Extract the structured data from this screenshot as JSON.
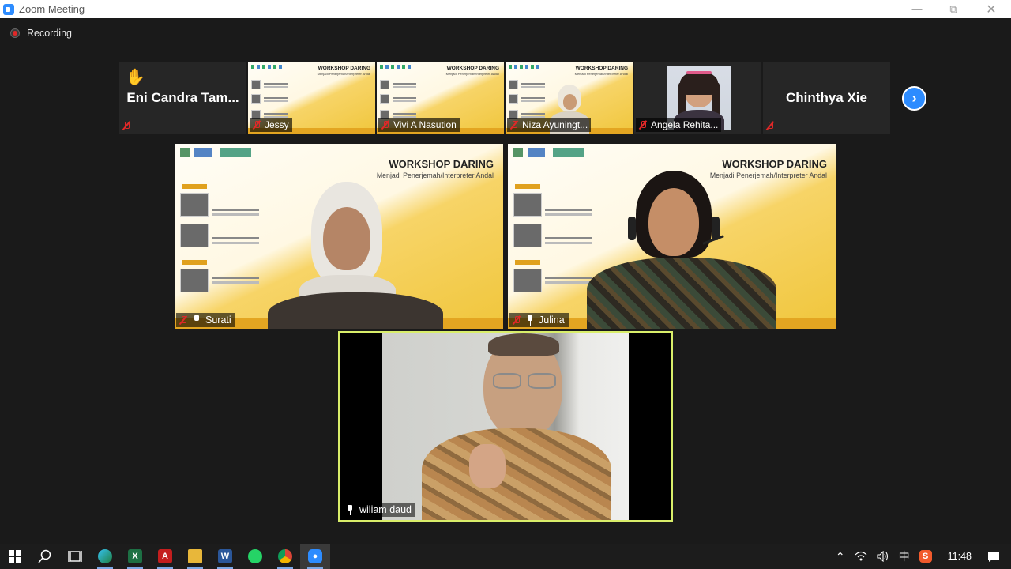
{
  "window": {
    "title": "Zoom Meeting"
  },
  "recording": {
    "label": "Recording"
  },
  "gallery_strip": [
    {
      "name": "Eni Candra Tam...",
      "type": "avatar-name",
      "raised_hand": true,
      "muted": true
    },
    {
      "name": "Jessy",
      "type": "video-slide",
      "muted": true
    },
    {
      "name": "Vivi A Nasution",
      "type": "video-slide",
      "muted": true
    },
    {
      "name": "Niza Ayuningt...",
      "type": "video-slide-person",
      "muted": true
    },
    {
      "name": "Angela Rehita...",
      "type": "video-person",
      "muted": true
    },
    {
      "name": "Chinthya Xie",
      "type": "avatar-name",
      "muted": true
    }
  ],
  "slide": {
    "title": "WORKSHOP DARING",
    "subtitle": "Menjadi Penerjemah/Interpreter Andal"
  },
  "speakers": [
    {
      "name": "Surati",
      "muted": true,
      "pinned": true
    },
    {
      "name": "Julina",
      "muted": true,
      "pinned": true
    }
  ],
  "active_speaker": {
    "name": "wiliam daud",
    "pinned": true
  },
  "taskbar": {
    "apps": [
      "windows-start",
      "search",
      "task-view",
      "edge",
      "excel",
      "acrobat",
      "file-explorer",
      "word",
      "whatsapp",
      "chrome",
      "zoom"
    ],
    "active_app": "zoom",
    "tray": {
      "ime": "中",
      "clock": "11:48"
    }
  },
  "colors": {
    "accent": "#2d8cff",
    "active_border": "#d9ee6a",
    "muted_red": "#e02828",
    "slide_yellow": "#f0c63c"
  }
}
